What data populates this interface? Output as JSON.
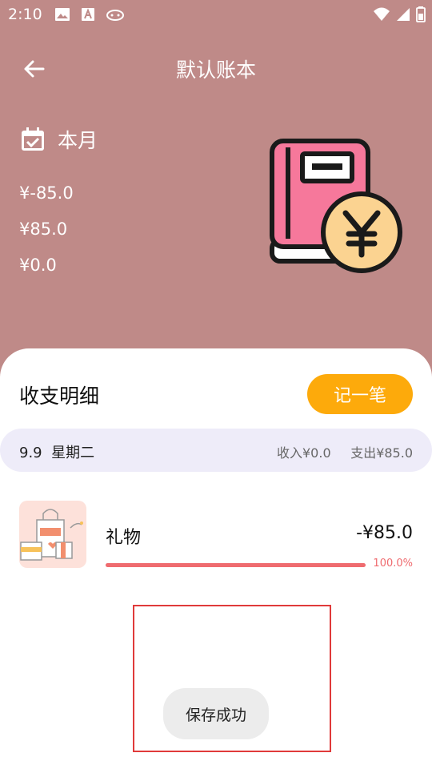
{
  "status_bar": {
    "time": "2:10"
  },
  "header": {
    "title": "默认账本",
    "period_label": "本月",
    "balance": "¥-85.0",
    "expense_total": "¥85.0",
    "income_total": "¥0.0"
  },
  "details": {
    "title": "收支明细",
    "add_button_label": "记一笔",
    "date_group": {
      "date": "9.9",
      "weekday": "星期二",
      "income": "收入¥0.0",
      "expense": "支出¥85.0"
    },
    "records": [
      {
        "category": "礼物",
        "amount": "-¥85.0",
        "percent_label": "100.0%",
        "percent": 100,
        "icon": "gift-bag-icon"
      }
    ]
  },
  "toast": {
    "message": "保存成功"
  },
  "colors": {
    "header_bg": "#bf8a88",
    "accent": "#fdaa0b",
    "progress": "#ef6b6f",
    "date_bar_bg": "#eeecf9"
  }
}
